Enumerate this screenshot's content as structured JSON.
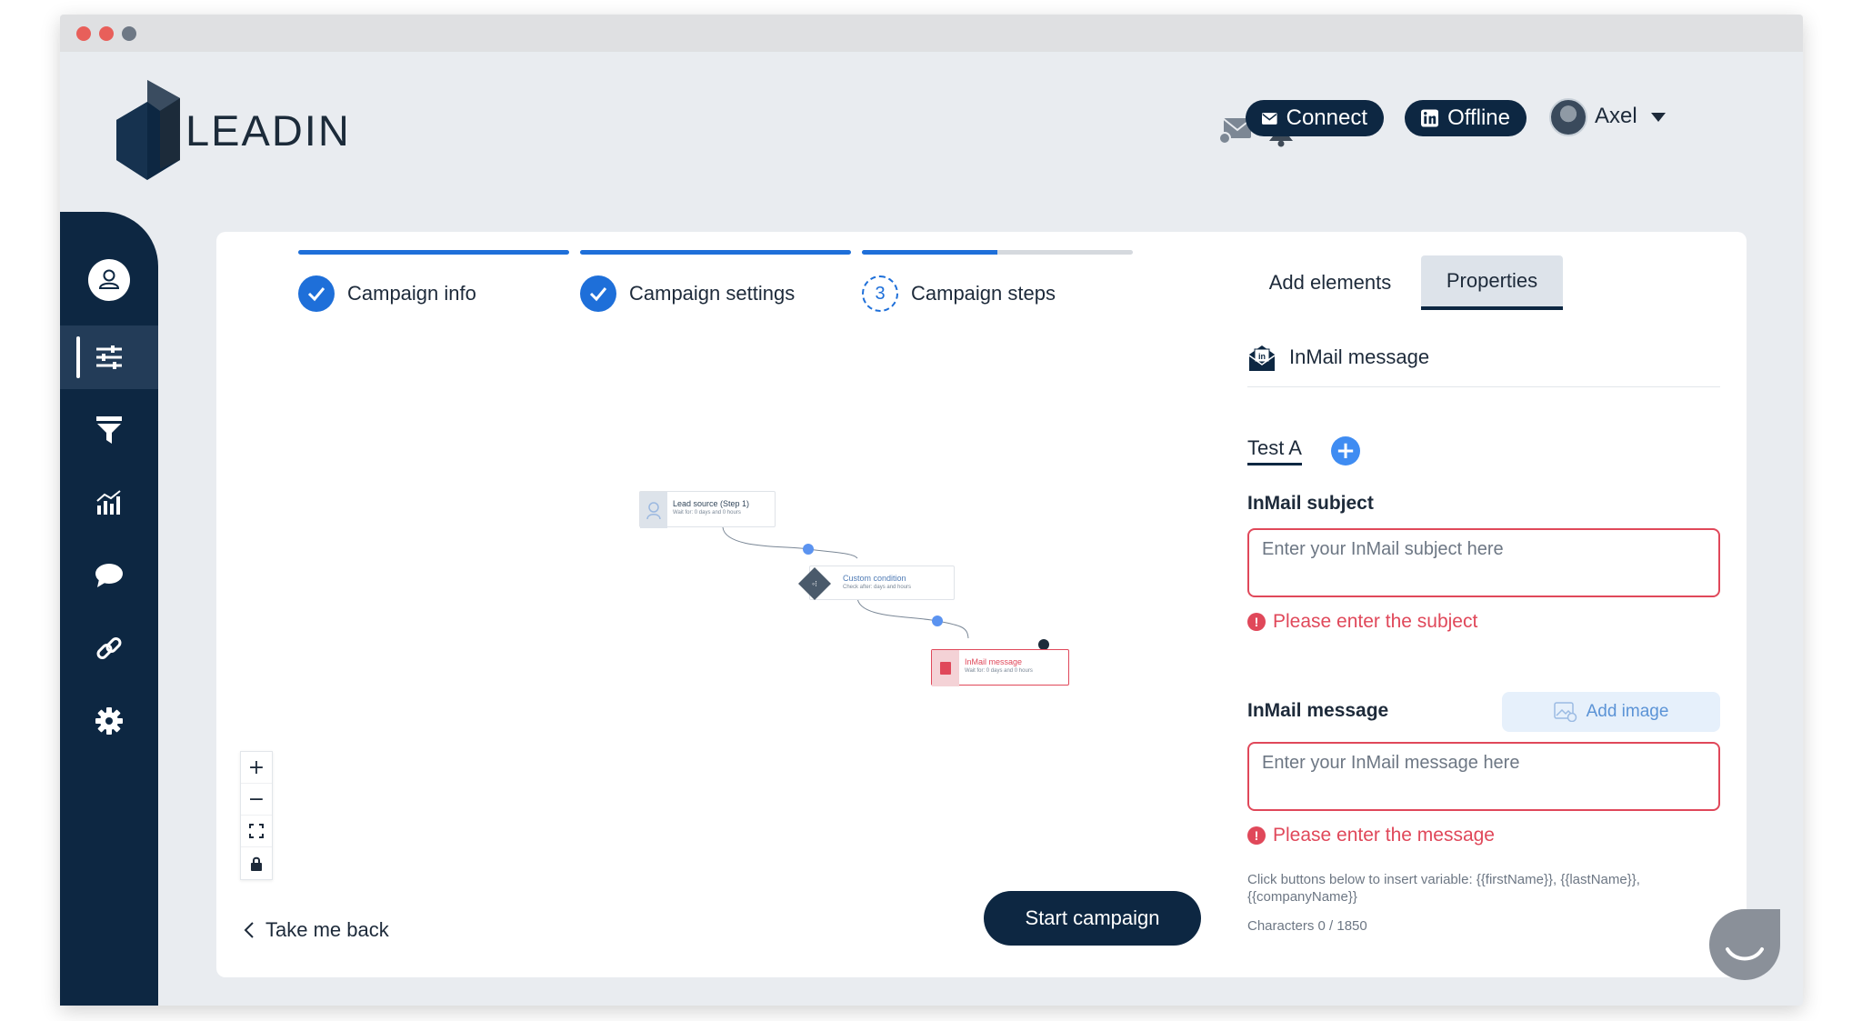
{
  "app": {
    "logo_text": "LEADIN"
  },
  "topbar": {
    "connect_label": "Connect",
    "offline_label": "Offline",
    "user_name": "Axel"
  },
  "sidebar": {
    "items": [
      {
        "icon": "user-icon"
      },
      {
        "icon": "sliders-icon",
        "active": true
      },
      {
        "icon": "filter-icon"
      },
      {
        "icon": "chart-icon"
      },
      {
        "icon": "chat-icon"
      },
      {
        "icon": "link-icon"
      },
      {
        "icon": "gear-icon"
      }
    ]
  },
  "wizard": {
    "steps": [
      {
        "label": "Campaign info",
        "state": "done",
        "progress": 1.0
      },
      {
        "label": "Campaign settings",
        "state": "done",
        "progress": 1.0
      },
      {
        "label": "Campaign steps",
        "state": "current",
        "number": "3",
        "progress": 0.5
      }
    ]
  },
  "tabs": {
    "add_elements": "Add elements",
    "properties": "Properties"
  },
  "flow": {
    "nodes": [
      {
        "title": "Lead source (Step 1)",
        "sub": "Wait for: 0 days and 0 hours"
      },
      {
        "title": "Custom condition",
        "sub": "Check after: days and hours"
      },
      {
        "title": "InMail message",
        "sub": "Wait for: 0 days and 0 hours"
      }
    ]
  },
  "footer": {
    "back_label": "Take me back",
    "start_label": "Start campaign"
  },
  "properties": {
    "header": "InMail message",
    "test_tab": "Test A",
    "subject_label": "InMail subject",
    "subject_placeholder": "Enter your InMail subject here",
    "subject_error": "Please enter the subject",
    "message_label": "InMail message",
    "add_image_label": "Add image",
    "message_placeholder": "Enter your InMail message here",
    "message_error": "Please enter the message",
    "hint": "Click buttons below to insert variable: {{firstName}}, {{lastName}}, {{companyName}}",
    "characters": "Characters 0 / 1850"
  },
  "colors": {
    "navy": "#0d2742",
    "blue": "#1e6fd9",
    "error": "#e0485a"
  }
}
